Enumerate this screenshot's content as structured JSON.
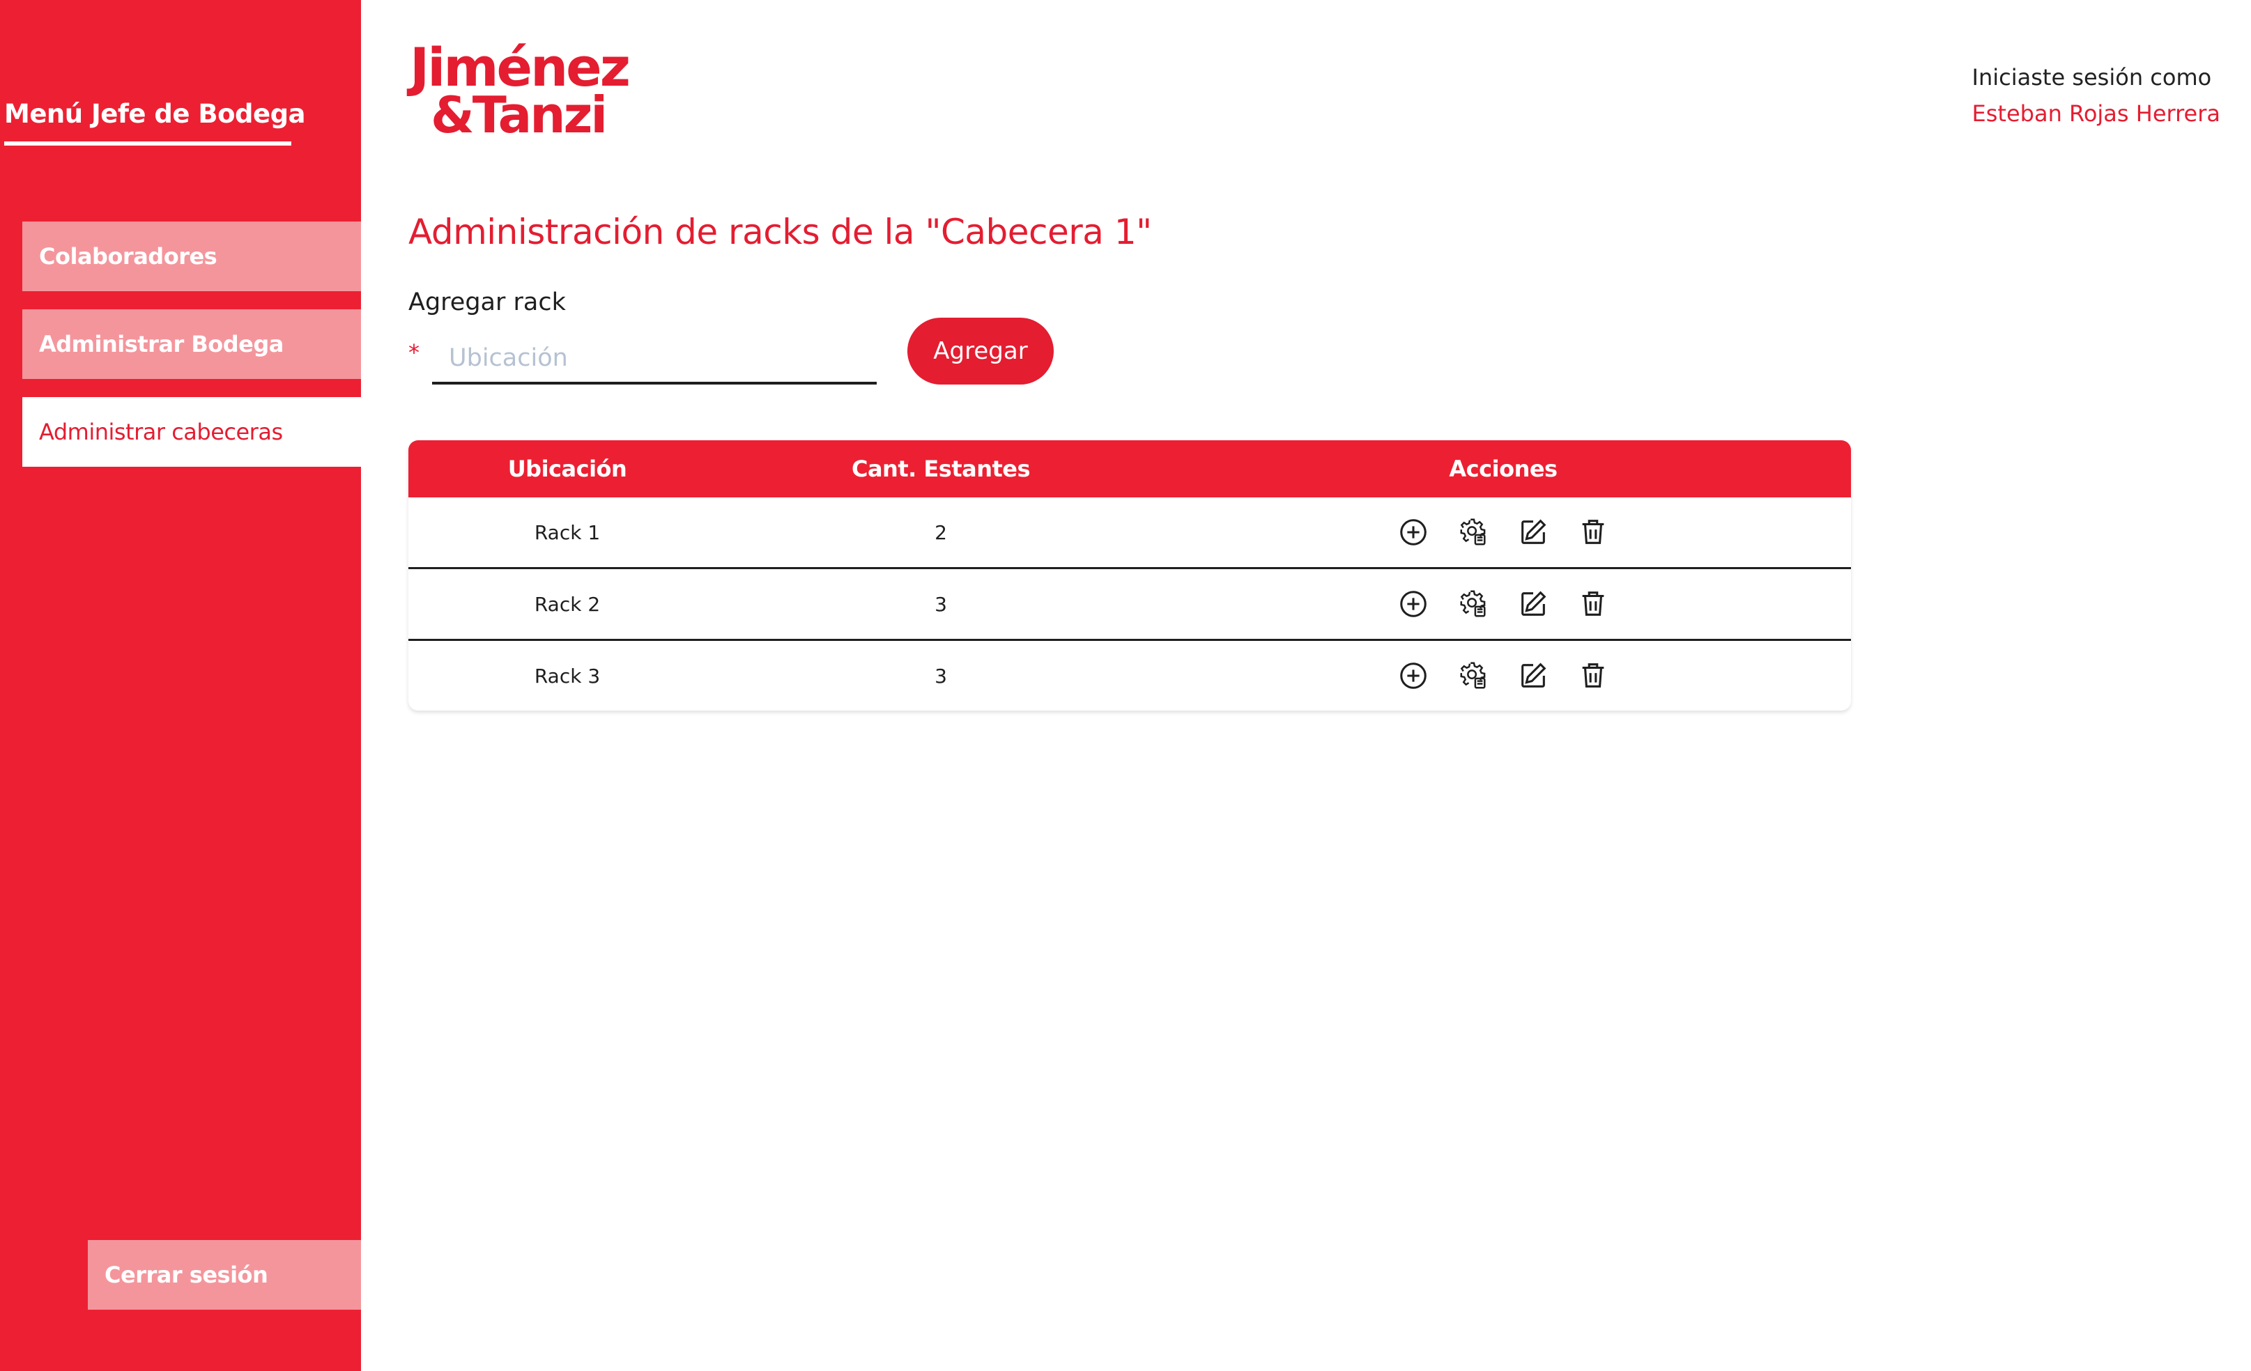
{
  "sidebar": {
    "title": "Menú Jefe de Bodega",
    "items": [
      {
        "label": "Colaboradores",
        "active": false
      },
      {
        "label": "Administrar Bodega",
        "active": false
      },
      {
        "label": "Administrar cabeceras",
        "active": true
      }
    ],
    "logout_label": "Cerrar sesión"
  },
  "brand": {
    "line1": "Jiménez",
    "line2": "&Tanzi"
  },
  "session": {
    "label": "Iniciaste sesión como",
    "user": "Esteban Rojas Herrera"
  },
  "page": {
    "title": "Administración de racks de la \"Cabecera 1\""
  },
  "add_form": {
    "label": "Agregar rack",
    "required_mark": "*",
    "input_placeholder": "Ubicación",
    "input_value": "",
    "button_label": "Agregar"
  },
  "table": {
    "headers": [
      "Ubicación",
      "Cant. Estantes",
      "Acciones"
    ],
    "rows": [
      {
        "location": "Rack 1",
        "shelves": "2"
      },
      {
        "location": "Rack 2",
        "shelves": "3"
      },
      {
        "location": "Rack 3",
        "shelves": "3"
      }
    ],
    "action_icons": [
      "plus-circle-icon",
      "gear-settings-icon",
      "edit-pencil-icon",
      "trash-icon"
    ]
  },
  "colors": {
    "brand_red": "#e41d31",
    "sidebar_red": "#ec2032",
    "nav_inactive": "#f4959c"
  }
}
